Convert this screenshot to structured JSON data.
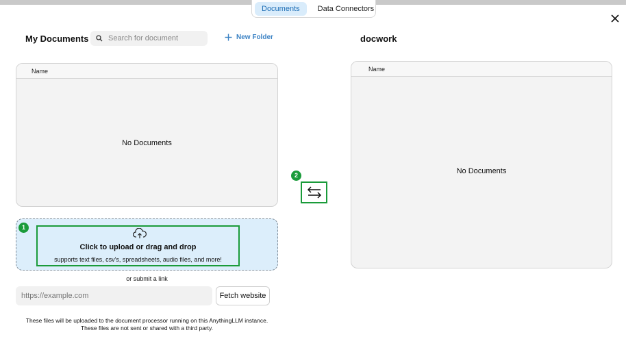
{
  "tabs": [
    {
      "label": "Documents",
      "active": true
    },
    {
      "label": "Data Connectors",
      "active": false
    }
  ],
  "left": {
    "title": "My Documents",
    "search_placeholder": "Search for document",
    "new_folder_label": "New Folder",
    "column_name": "Name",
    "empty_text": "No Documents"
  },
  "upload": {
    "badge": "1",
    "title": "Click to upload or drag and drop",
    "subtitle": "supports text files, csv's, spreadsheets, audio files, and more!",
    "icon": "cloud-upload-icon"
  },
  "link": {
    "or_label": "or submit a link",
    "url_placeholder": "https://example.com",
    "fetch_label": "Fetch website"
  },
  "note": {
    "line1": "These files will be uploaded to the document processor running on this AnythingLLM instance.",
    "line2": "These files are not sent or shared with a third party."
  },
  "swap": {
    "badge": "2",
    "icon": "swap-arrows-icon"
  },
  "right": {
    "title": "docwork",
    "column_name": "Name",
    "empty_text": "No Documents"
  },
  "colors": {
    "accent_green": "#1a9b3a",
    "active_tab_bg": "#d9ecfb",
    "link_blue": "#3b82c4",
    "upload_bg": "#dceefb"
  }
}
